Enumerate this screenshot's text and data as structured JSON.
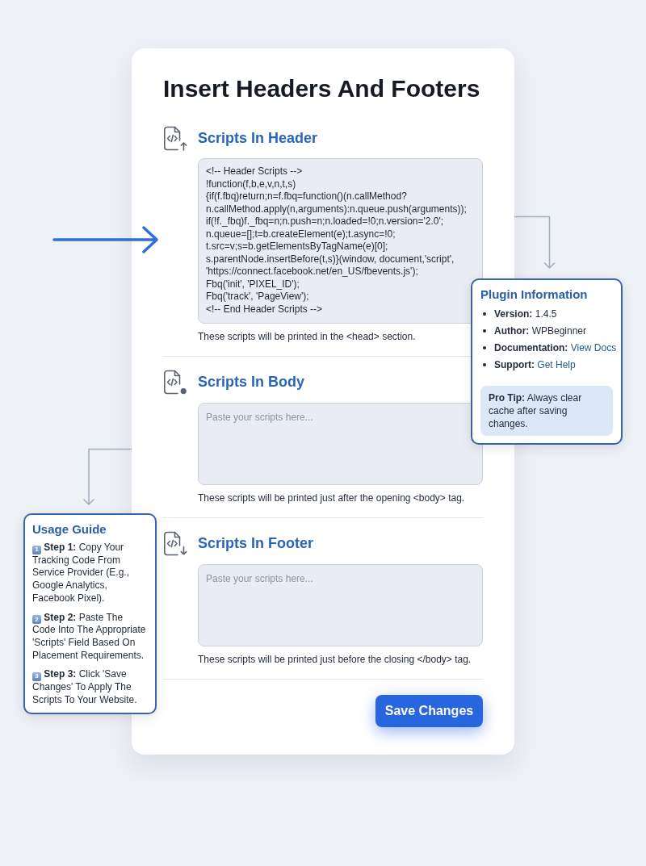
{
  "page": {
    "title": "Insert Headers And Footers"
  },
  "sections": [
    {
      "kind": "up",
      "heading": "Scripts In Header",
      "value": "<!-- Header Scripts -->\n!function(f,b,e,v,n,t,s)\n{if(f.fbq)return;n=f.fbq=function()(n.callMethod?\nn.callMethod.apply(n,arguments):n.queue.push(arguments));\nif(!f._fbq)f._fbq=n;n.push=n;n.loaded=!0;n.version='2.0';\nn.queue=[];t=b.createElement(e);t.async=!0;\nt.src=v;s=b.getElementsByTagName(e)[0];\ns.parentNode.insertBefore(t,s)}(window, document,'script',\n'https://connect.facebook.net/en_US/fbevents.js');\nFbq('init', 'PIXEL_ID');\nFbq('track', 'PageView');\n<!-- End Header Scripts -->",
      "help": "These scripts will be printed in the <head> section."
    },
    {
      "kind": "dot",
      "heading": "Scripts In Body",
      "placeholder": "Paste your scripts here...",
      "help": "These scripts will be printed just after the opening <body> tag."
    },
    {
      "kind": "down",
      "heading": "Scripts In Footer",
      "placeholder": "Paste your scripts here...",
      "help": "These scripts will be printed just before the closing </body> tag."
    }
  ],
  "save_button": {
    "label": "Save Changes"
  },
  "plugin_info": {
    "title": "Plugin Information",
    "items": [
      {
        "kind": "text",
        "label": "Version:",
        "value": "1.4.5"
      },
      {
        "kind": "text",
        "label": "Author:",
        "value": "WPBeginner"
      },
      {
        "kind": "link",
        "label": "Documentation:",
        "value": "View Docs"
      },
      {
        "kind": "link",
        "label": "Support:",
        "value": "Get Help"
      }
    ],
    "tip": "**Pro Tip:** Always clear cache after saving changes."
  },
  "usage_guide": {
    "title": "Usage Guide",
    "steps": [
      {
        "number": "1",
        "text": "**Step 1:** Copy Your Tracking Code From Service Provider (E.g., Google Analytics, Facebook Pixel)."
      },
      {
        "number": "2",
        "text": "**Step 2:** Paste The Code Into The Appropriate 'Scripts' Field Based On Placement Requirements."
      },
      {
        "number": "3",
        "text": "**Step 3:** Click 'Save Changes' To Apply The Scripts To Your Website."
      }
    ]
  }
}
